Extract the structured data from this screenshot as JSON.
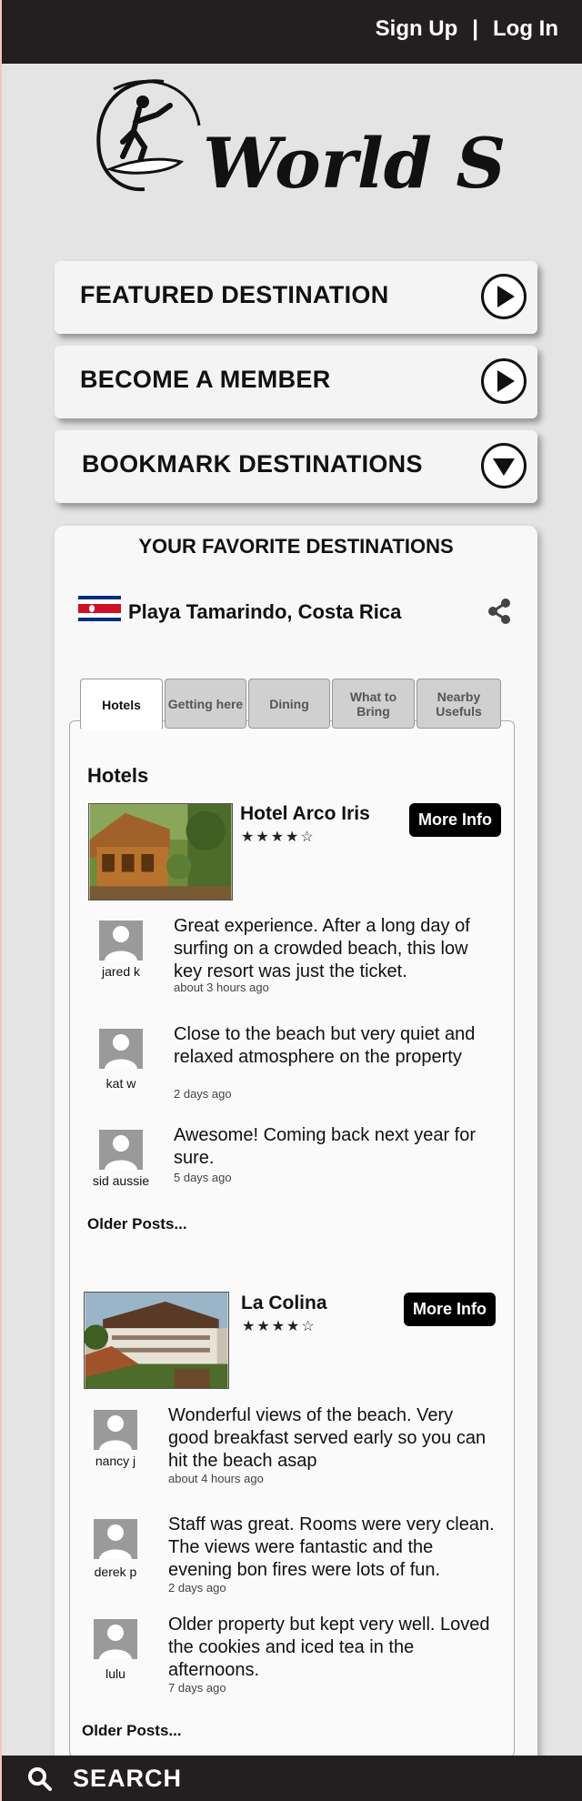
{
  "header": {
    "sign_up": "Sign Up",
    "divider": "|",
    "log_in": "Log In"
  },
  "brand": {
    "name": "World Surf"
  },
  "menu": [
    {
      "label": "FEATURED DESTINATION",
      "icon": "play-icon"
    },
    {
      "label": "BECOME A MEMBER",
      "icon": "play-icon"
    },
    {
      "label": "BOOKMARK DESTINATIONS",
      "icon": "chevron-down-icon"
    }
  ],
  "favorites": {
    "title": "YOUR FAVORITE DESTINATIONS",
    "destination": "Playa Tamarindo, Costa Rica",
    "tabs": [
      "Hotels",
      "Getting here",
      "Dining",
      "What to Bring",
      "Nearby Usefuls"
    ],
    "active_tab": "Hotels",
    "section_title": "Hotels",
    "hotels": [
      {
        "name": "Hotel Arco Iris",
        "stars": "★★★★☆",
        "rating": 4,
        "more_info": "More Info",
        "reviews": [
          {
            "user": "jared k",
            "text": "Great experience. After a long day of surfing on a crowded beach, this low key resort was just the ticket.",
            "time": "about 3 hours ago"
          },
          {
            "user": "kat w",
            "text": "Close to the beach but very quiet and relaxed atmosphere on the property",
            "time": "2 days ago"
          },
          {
            "user": "sid aussie",
            "text": "Awesome! Coming back next year for sure.",
            "time": "5 days ago"
          }
        ],
        "older_posts": "Older Posts..."
      },
      {
        "name": "La Colina",
        "stars": "★★★★☆",
        "rating": 4,
        "more_info": "More Info",
        "reviews": [
          {
            "user": "nancy j",
            "text": "Wonderful views of the beach. Very good breakfast served early so you can hit the beach asap",
            "time": "about 4 hours ago"
          },
          {
            "user": "derek p",
            "text": "Staff was great.  Rooms were very clean. The views were fantastic and the evening bon fires were lots of fun.",
            "time": "2 days ago"
          },
          {
            "user": "lulu",
            "text": "Older property but kept very well. Loved the cookies and iced tea in the afternoons.",
            "time": "7 days ago"
          }
        ],
        "older_posts": "Older Posts..."
      }
    ]
  },
  "search": {
    "label": "SEARCH"
  }
}
